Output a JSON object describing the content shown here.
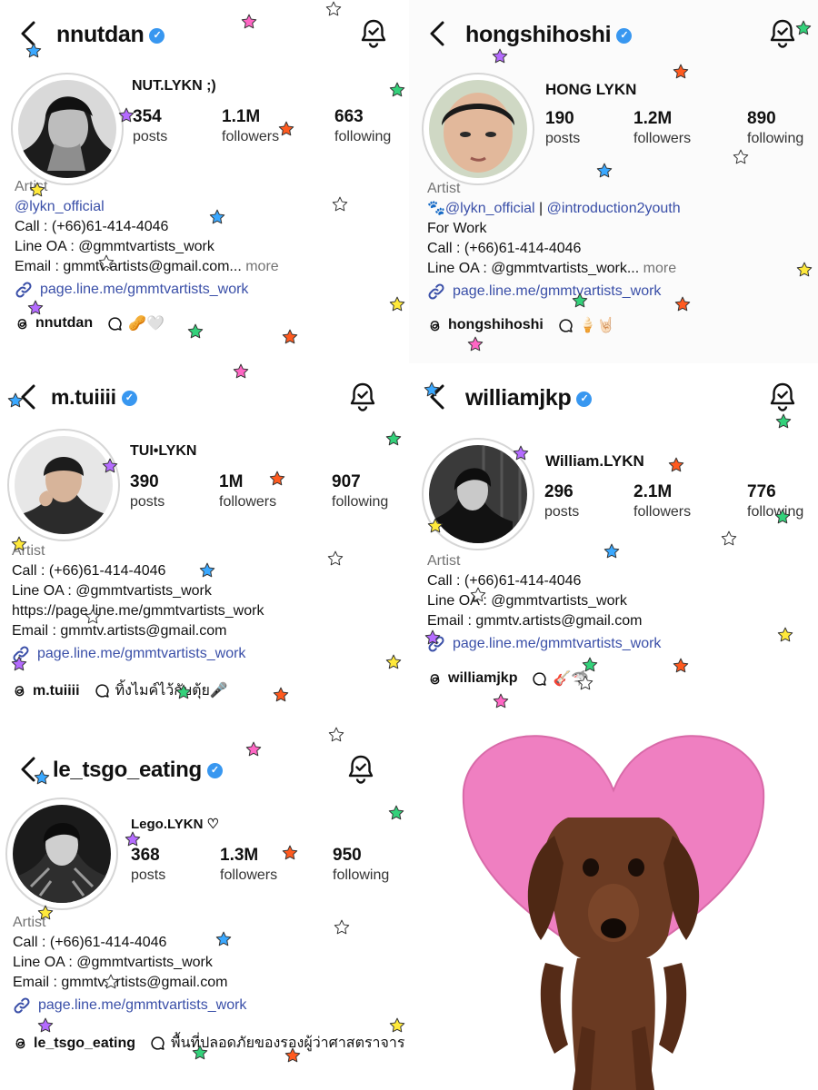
{
  "panels": [
    {
      "username": "nnutdan",
      "display_name": "NUT.LYKN ;)",
      "stats": [
        {
          "num": "354",
          "label": "posts"
        },
        {
          "num": "1.1M",
          "label": "followers"
        },
        {
          "num": "663",
          "label": "following"
        }
      ],
      "bio": [
        "Artist",
        "@lykn_official",
        "Call : (+66)61-414-4046",
        "Line OA : @gmmtvartists_work",
        "Email : gmmtv.artists@gmail.com...",
        "more"
      ],
      "link": "page.line.me/gmmtvartists_work",
      "threads": {
        "handle": "nnutdan",
        "note": "🥜🤍"
      }
    },
    {
      "username": "hongshihoshi",
      "display_name": "HONG LYKN",
      "stats": [
        {
          "num": "190",
          "label": "posts"
        },
        {
          "num": "1.2M",
          "label": "followers"
        },
        {
          "num": "890",
          "label": "following"
        }
      ],
      "bio": [
        "Artist",
        "🐾",
        "@lykn_official",
        "|",
        "@introduction2youth",
        "For Work",
        "Call : (+66)61-414-4046",
        "Line OA : @gmmtvartists_work...",
        "more"
      ],
      "link": "page.line.me/gmmtvartists_work",
      "threads": {
        "handle": "hongshihoshi",
        "note": "🍦🤘🏻"
      }
    },
    {
      "username": "m.tuiiii",
      "display_name": "TUI•LYKN",
      "stats": [
        {
          "num": "390",
          "label": "posts"
        },
        {
          "num": "1M",
          "label": "followers"
        },
        {
          "num": "907",
          "label": "following"
        }
      ],
      "bio": [
        "Artist",
        "Call : (+66)61-414-4046",
        "Line OA : @gmmtvartists_work",
        "https://page.line.me/gmmtvartists_work",
        "Email : gmmtv.artists@gmail.com"
      ],
      "link": "page.line.me/gmmtvartists_work",
      "threads": {
        "handle": "m.tuiiii",
        "note": "ทิ้งไมค์ไว้กับตุ้ย🎤"
      }
    },
    {
      "username": "williamjkp",
      "display_name": "William.LYKN",
      "stats": [
        {
          "num": "296",
          "label": "posts"
        },
        {
          "num": "2.1M",
          "label": "followers"
        },
        {
          "num": "776",
          "label": "following"
        }
      ],
      "bio": [
        "Artist",
        "Call : (+66)61-414-4046",
        "Line OA : @gmmtvartists_work",
        "Email : gmmtv.artists@gmail.com"
      ],
      "link": "page.line.me/gmmtvartists_work",
      "threads": {
        "handle": "williamjkp",
        "note": "🎸🦈"
      }
    },
    {
      "username": "le_tsgo_eating",
      "display_name": "Lego.LYKN ♡",
      "stats": [
        {
          "num": "368",
          "label": "posts"
        },
        {
          "num": "1.3M",
          "label": "followers"
        },
        {
          "num": "950",
          "label": "following"
        }
      ],
      "bio": [
        "Artist",
        "Call : (+66)61-414-4046",
        "Line OA : @gmmtvartists_work",
        "Email : gmmtv.artists@gmail.com"
      ],
      "link": "page.line.me/gmmtvartists_work",
      "threads": {
        "handle": "le_tsgo_eating",
        "note": "พื้นที่ปลอดภัยของรองผู้ว่าศาสตราจาร"
      }
    }
  ],
  "icons": {
    "back": "chevron-left-icon",
    "verified": "verified-badge-icon",
    "notifications": "bell-check-icon",
    "link": "link-icon",
    "threads": "threads-icon",
    "note": "speech-bubble-icon",
    "decoration": "star-icon"
  },
  "colors": {
    "link_blue": "#3a4fa8",
    "verified_blue": "#3897f0",
    "heart_pink": "#ef7fc1",
    "star_colors": [
      "#ff66c4",
      "#ffe93b",
      "#3aa8ff",
      "#33d17a",
      "#b46bff",
      "#ff5a1f",
      "#ffffff"
    ]
  }
}
